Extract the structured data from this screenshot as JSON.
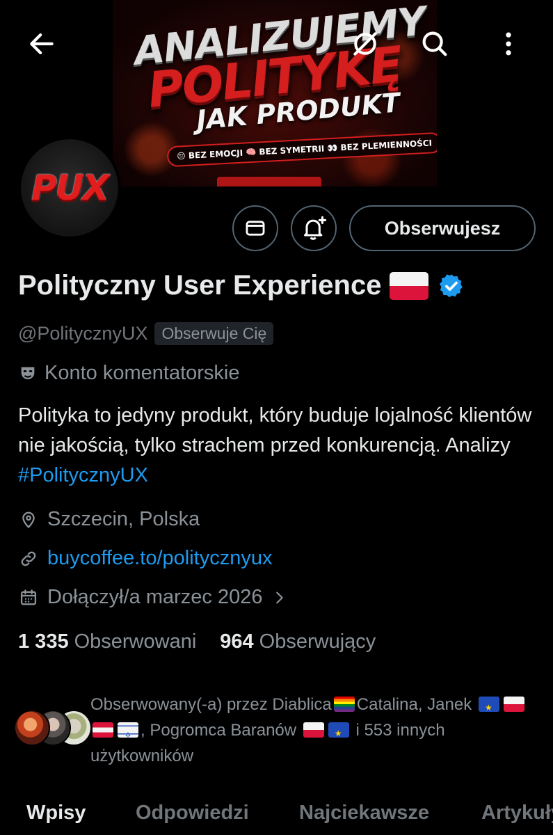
{
  "banner": {
    "line1": "ANALIZUJEMY",
    "line2": "POLITYKĘ",
    "line3": "JAK PRODUKT",
    "pill": "😔 BEZ EMOCJI 🧠 BEZ SYMETRII 👀 BEZ PLEMIENNOŚCI"
  },
  "header": {
    "back_icon": "arrow-left-icon",
    "grok_icon": "grok-icon",
    "search_icon": "search-icon",
    "more_icon": "more-vertical-icon"
  },
  "avatar": {
    "text": "PUX"
  },
  "actions": {
    "message_icon": "envelope-icon",
    "notify_icon": "bell-plus-icon",
    "follow_label": "Obserwujesz"
  },
  "profile": {
    "name": "Polityczny User Experience",
    "handle": "@PolitycznyUX",
    "follows_you": "Obserwuje Cię",
    "label": "Konto komentatorskie",
    "bio_text": "Polityka to jedyny produkt, który buduje lojalność klientów nie jakością, tylko strachem przed konkurencją. Analizy ",
    "bio_hashtag": "#PolitycznyUX",
    "location": "Szczecin, Polska",
    "link": "buycoffee.to/politycznyux",
    "joined": "Dołączył/a marzec 2026"
  },
  "stats": {
    "following_count": "1 335",
    "following_label": "Obserwowani",
    "followers_count": "964",
    "followers_label": "Obserwujący"
  },
  "followed_by": {
    "part1": "Obserwowany(-a) przez Diablica",
    "part2": "Catalina, Janek",
    "part3": ", Pogromca Baranów",
    "part4": "i 553 innych użytkowników"
  },
  "tabs": [
    "Wpisy",
    "Odpowiedzi",
    "Najciekawsze",
    "Artykuły"
  ],
  "colors": {
    "accent": "#1d9bf0",
    "muted": "#71767b",
    "background": "#000000"
  }
}
